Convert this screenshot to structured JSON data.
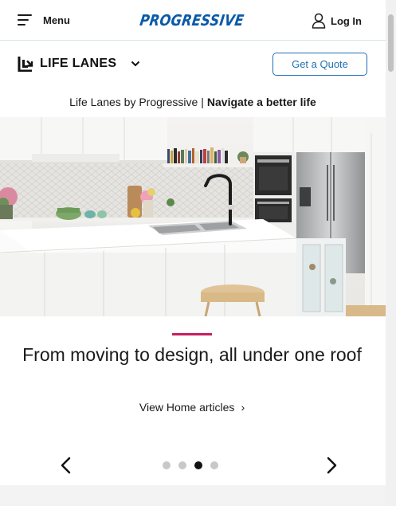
{
  "header": {
    "menu_label": "Menu",
    "brand": "PROGRESSIVE",
    "login_label": "Log In"
  },
  "subheader": {
    "section_name": "LIFE LANES",
    "quote_button": "Get a Quote"
  },
  "tagline": {
    "prefix": "Life Lanes by Progressive",
    "separator": "|",
    "emphasis": "Navigate a better life"
  },
  "article": {
    "headline": "From moving to design, all under one roof",
    "link_label": "View Home articles",
    "link_chevron": "›"
  },
  "carousel": {
    "slide_count": 4,
    "active_index": 2
  },
  "colors": {
    "brand_blue": "#0a5aa8",
    "quote_blue": "#1f6fb2",
    "accent_pink": "#c81e63"
  },
  "icons": {
    "menu": "hamburger-icon",
    "login": "user-icon",
    "section": "life-lanes-icon",
    "dropdown": "chevron-down-icon",
    "prev": "chevron-left-icon",
    "next": "chevron-right-icon"
  }
}
